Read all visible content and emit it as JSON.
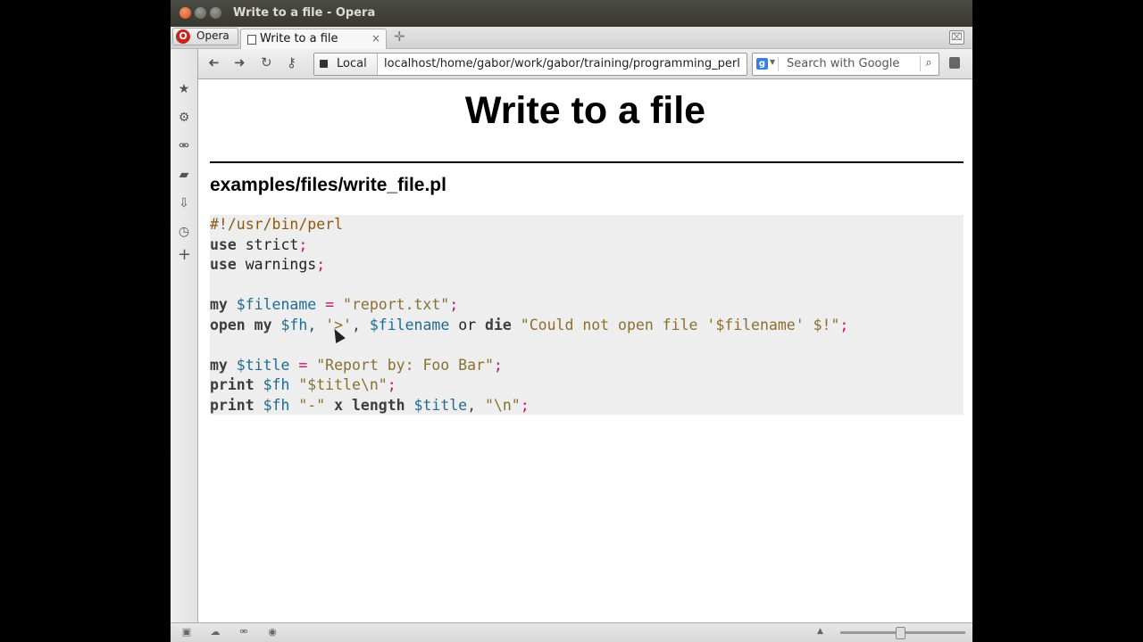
{
  "window": {
    "title": "Write to a file - Opera"
  },
  "menu": {
    "label": "Opera",
    "logo_letter": "O"
  },
  "tab": {
    "label": "Write to a file",
    "close": "×"
  },
  "new_tab": "✛",
  "nav": {
    "back_icon": "back-arrow",
    "forward_icon": "forward-arrow",
    "reload_icon": "reload",
    "key_icon": "key",
    "site_badge": "Local",
    "url": "localhost/home/gabor/work/gabor/training/programming_perl"
  },
  "search": {
    "placeholder": "Search with Google",
    "engine_letter": "g"
  },
  "sidebar": {
    "items": [
      "bookmarks-icon",
      "settings-icon",
      "unite-icon",
      "notes-icon",
      "downloads-icon",
      "history-icon",
      "add-panel-icon"
    ]
  },
  "page": {
    "title": "Write to a file",
    "file_heading": "examples/files/write_file.pl"
  },
  "code": {
    "lines": [
      [
        {
          "t": "#!/usr/bin/perl",
          "c": "comment"
        }
      ],
      [
        {
          "t": "use",
          "c": "kw"
        },
        {
          "t": " strict",
          "c": "fn"
        },
        {
          "t": ";",
          "c": "op"
        }
      ],
      [
        {
          "t": "use",
          "c": "kw"
        },
        {
          "t": " warnings",
          "c": "fn"
        },
        {
          "t": ";",
          "c": "op"
        }
      ],
      [],
      [
        {
          "t": "my",
          "c": "kw"
        },
        {
          "t": " $filename",
          "c": "var"
        },
        {
          "t": " = ",
          "c": "op"
        },
        {
          "t": "\"report.txt\"",
          "c": "str"
        },
        {
          "t": ";",
          "c": "op"
        }
      ],
      [
        {
          "t": "open",
          "c": "kw"
        },
        {
          "t": " my",
          "c": "kw"
        },
        {
          "t": " $fh",
          "c": "var"
        },
        {
          "t": ", ",
          "c": "sep"
        },
        {
          "t": "'>'",
          "c": "str"
        },
        {
          "t": ", ",
          "c": "sep"
        },
        {
          "t": "$filename",
          "c": "var"
        },
        {
          "t": " or",
          "c": "fn"
        },
        {
          "t": " die",
          "c": "kw"
        },
        {
          "t": " \"Could not open file '$filename' $!\"",
          "c": "str"
        },
        {
          "t": ";",
          "c": "op"
        }
      ],
      [],
      [
        {
          "t": "my",
          "c": "kw"
        },
        {
          "t": " $title",
          "c": "var"
        },
        {
          "t": " = ",
          "c": "op"
        },
        {
          "t": "\"Report by: Foo Bar\"",
          "c": "str"
        },
        {
          "t": ";",
          "c": "op"
        }
      ],
      [
        {
          "t": "print",
          "c": "kw"
        },
        {
          "t": " $fh",
          "c": "var"
        },
        {
          "t": " \"$title\\n\"",
          "c": "str"
        },
        {
          "t": ";",
          "c": "op"
        }
      ],
      [
        {
          "t": "print",
          "c": "kw"
        },
        {
          "t": " $fh",
          "c": "var"
        },
        {
          "t": " \"-\"",
          "c": "str"
        },
        {
          "t": " x length",
          "c": "kw"
        },
        {
          "t": " $title",
          "c": "var"
        },
        {
          "t": ", ",
          "c": "sep"
        },
        {
          "t": "\"\\n\"",
          "c": "str"
        },
        {
          "t": ";",
          "c": "op"
        }
      ]
    ]
  },
  "colors": {
    "comment": "#8a5a12",
    "keyword": "#3e3e3e",
    "operator": "#c8146e",
    "variable": "#1d6c93",
    "string": "#8a6f32",
    "code_background": "#eeeeee"
  }
}
